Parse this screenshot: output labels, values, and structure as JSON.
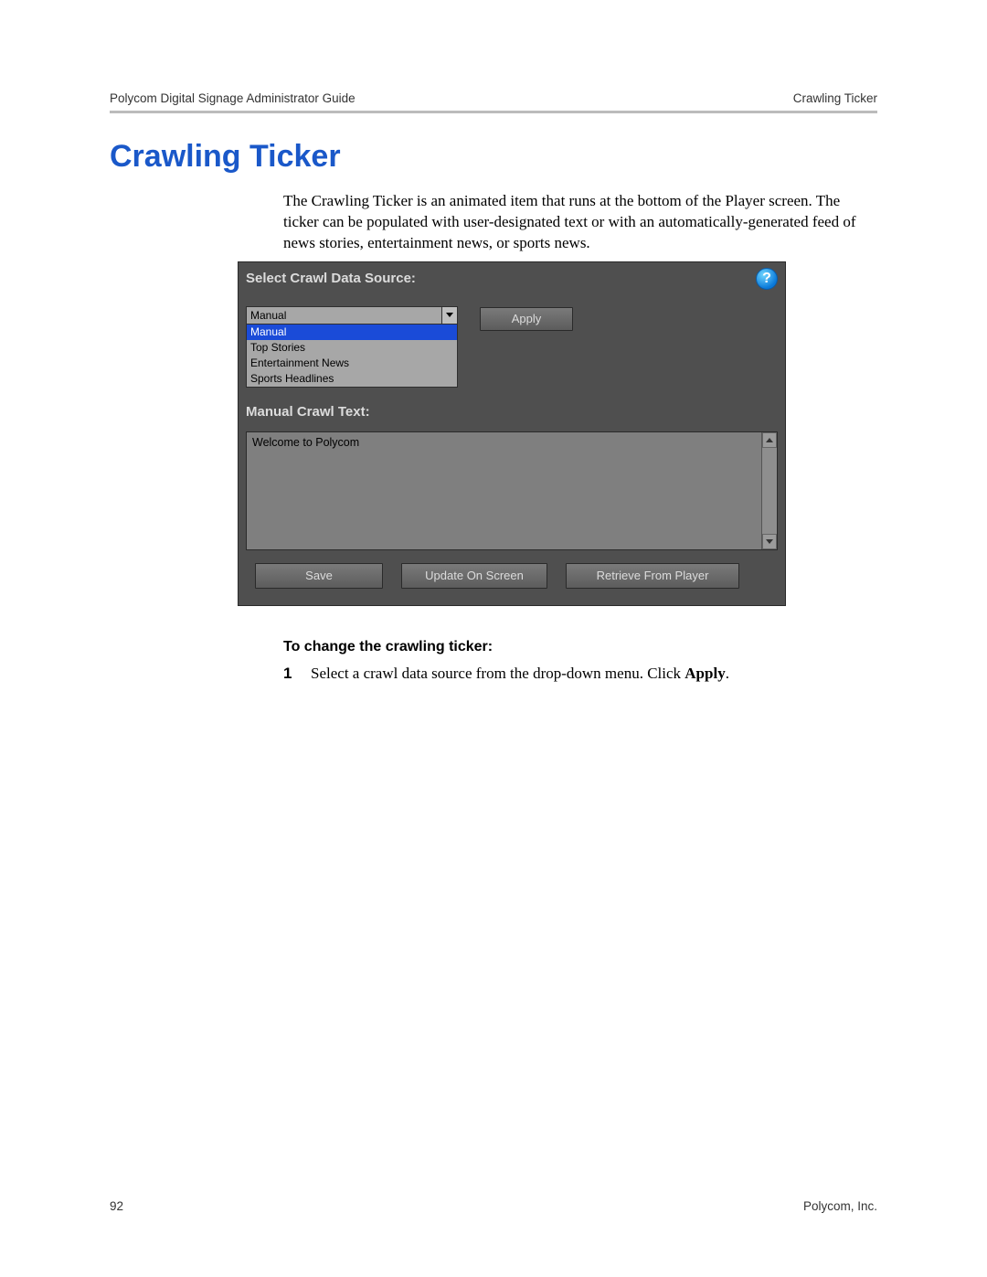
{
  "header": {
    "left": "Polycom Digital Signage Administrator Guide",
    "right": "Crawling Ticker"
  },
  "title": "Crawling Ticker",
  "intro": "The Crawling Ticker is an animated item that runs at the bottom of the Player screen. The ticker can be populated with user-designated text or with an automatically-generated feed of news stories, entertainment news, or sports news.",
  "panel": {
    "source_label": "Select Crawl Data Source:",
    "combo_value": "Manual",
    "options": [
      "Manual",
      "Top Stories",
      "Entertainment News",
      "Sports Headlines"
    ],
    "apply": "Apply",
    "manual_label": "Manual Crawl Text:",
    "textarea_value": "Welcome to Polycom",
    "save": "Save",
    "update": "Update On Screen",
    "retrieve": "Retrieve From Player",
    "help": "?"
  },
  "subheading": "To change the crawling ticker:",
  "step": {
    "num": "1",
    "text_a": "Select a crawl data source from the drop-down menu. Click ",
    "text_b": "Apply",
    "text_c": "."
  },
  "footer": {
    "page": "92",
    "company": "Polycom, Inc."
  }
}
